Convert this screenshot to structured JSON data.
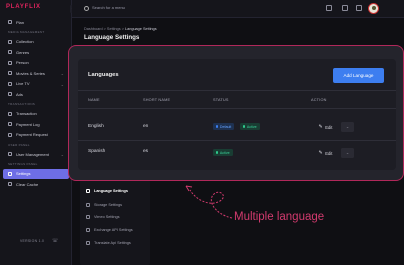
{
  "app": {
    "logo": "PLAYFLIX",
    "version": "VERSION 1.0"
  },
  "sidebar": {
    "items": [
      {
        "label": "Plan",
        "section": ""
      },
      {
        "label": "Collection",
        "section": "MEDIA MANAGEMENT"
      },
      {
        "label": "Genres"
      },
      {
        "label": "Person"
      },
      {
        "label": "Movies & Series",
        "chevron": true
      },
      {
        "label": "Live TV",
        "chevron": true
      },
      {
        "label": "Ads"
      },
      {
        "label": "Transaction",
        "section": "TRANSACTIONS"
      },
      {
        "label": "Payment Log"
      },
      {
        "label": "Payment Request"
      },
      {
        "label": "User Management",
        "section": "USER PANEL",
        "chevron": true
      },
      {
        "label": "Settings",
        "section": "SETTINGS PANEL",
        "active": true
      },
      {
        "label": "Clear Cache"
      }
    ]
  },
  "topbar": {
    "search_placeholder": "Search for a menu"
  },
  "breadcrumb": {
    "dashboard": "Dashboard",
    "settings": "Settings",
    "current": "Language Settings",
    "sep": ">"
  },
  "page": {
    "title": "Language Settings"
  },
  "settings_menu": [
    {
      "label": "Language Settings",
      "active": true
    },
    {
      "label": "Storage Settings"
    },
    {
      "label": "Vimeo Settings"
    },
    {
      "label": "Exchange API Settings"
    },
    {
      "label": "Translate Api Settings"
    }
  ],
  "languages": {
    "title": "Languages",
    "add_button": "Add Language",
    "columns": [
      "NAME",
      "SHORT NAME",
      "STATUS",
      "ACTION"
    ],
    "rows": [
      {
        "name": "English",
        "short": "en",
        "badges": [
          "Default",
          "Active"
        ],
        "edit": "Edit"
      },
      {
        "name": "Spanish",
        "short": "es",
        "badges": [
          "Active"
        ],
        "edit": "Edit"
      }
    ]
  },
  "annotation": {
    "text": "Multiple language",
    "color": "#d23a6e"
  },
  "colors": {
    "accent": "#6e6ee6",
    "primary_button": "#3d7ef0",
    "brand": "#e0245e",
    "highlight_border": "#b0285a"
  }
}
